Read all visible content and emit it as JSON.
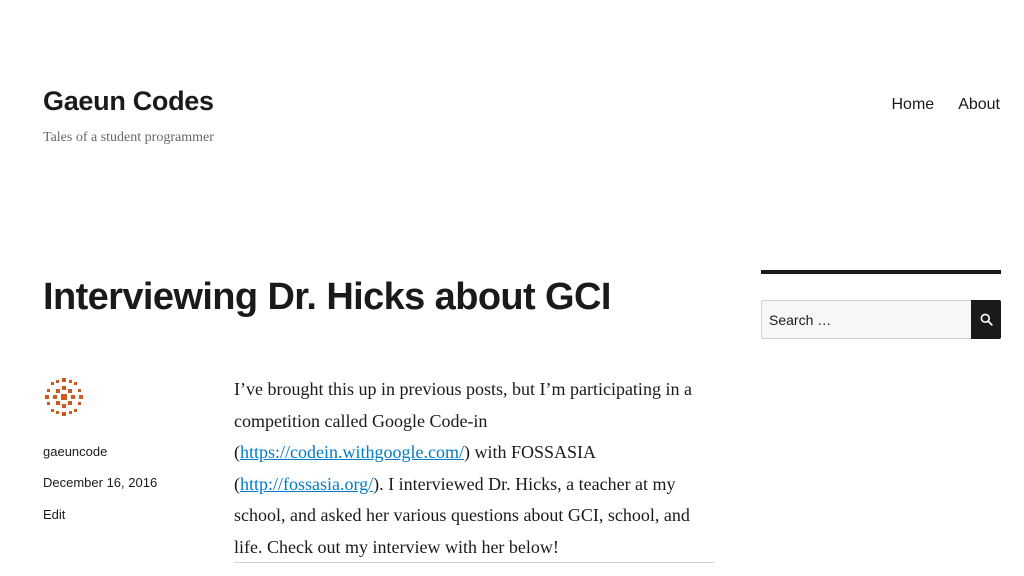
{
  "site": {
    "title": "Gaeun Codes",
    "description": "Tales of a student programmer"
  },
  "nav": {
    "items": [
      {
        "label": "Home"
      },
      {
        "label": "About"
      }
    ]
  },
  "post": {
    "title": "Interviewing Dr. Hicks about GCI",
    "author": "gaeuncode",
    "date": "December 16, 2016",
    "edit_label": "Edit",
    "paragraph": {
      "part1": "I’ve brought this up in previous posts, but I’m participating in a competition called Google Code-in (",
      "link1": "https://codein.withgoogle.com/",
      "part2": ") with FOSSASIA (",
      "link2": "http://fossasia.org/",
      "part3": "). I interviewed Dr. Hicks, a teacher at my school, and asked her various questions about GCI, school, and life. Check out my interview with her below!"
    }
  },
  "sidebar": {
    "search_placeholder": "Search …",
    "search_icon": "search-icon"
  },
  "colors": {
    "text": "#1a1a1a",
    "muted": "#686868",
    "link": "#007acc",
    "avatar": "#d2571d"
  }
}
